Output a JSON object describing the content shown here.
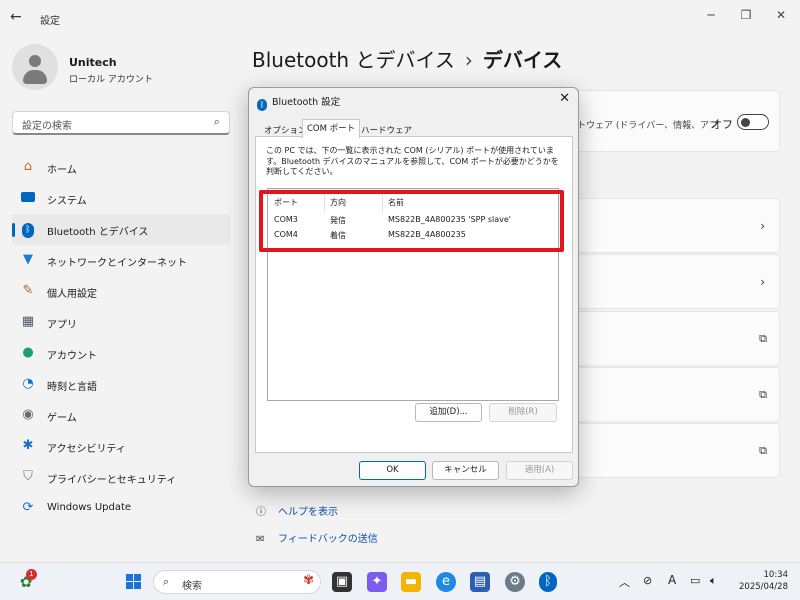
{
  "window": {
    "title": "設定",
    "back_icon": "arrow-left-icon"
  },
  "user": {
    "name": "Unitech",
    "account_type": "ローカル アカウント"
  },
  "search": {
    "placeholder": "設定の検索"
  },
  "sidebar": {
    "items": [
      {
        "label": "ホーム",
        "icon": "home-icon",
        "color": "#c86a1e"
      },
      {
        "label": "システム",
        "icon": "monitor-icon",
        "color": "#0067c0"
      },
      {
        "label": "Bluetooth とデバイス",
        "icon": "bluetooth-icon",
        "color": "#0067c0",
        "active": true
      },
      {
        "label": "ネットワークとインターネット",
        "icon": "wifi-icon",
        "color": "#1a7fd4"
      },
      {
        "label": "個人用設定",
        "icon": "brush-icon",
        "color": "#b5651d"
      },
      {
        "label": "アプリ",
        "icon": "apps-icon",
        "color": "#4a5a6a"
      },
      {
        "label": "アカウント",
        "icon": "person-icon",
        "color": "#1f9e75"
      },
      {
        "label": "時刻と言語",
        "icon": "globe-clock-icon",
        "color": "#1a6fc4"
      },
      {
        "label": "ゲーム",
        "icon": "gamepad-icon",
        "color": "#6b6b6b"
      },
      {
        "label": "アクセシビリティ",
        "icon": "accessibility-icon",
        "color": "#1a6fc4"
      },
      {
        "label": "プライバシーとセキュリティ",
        "icon": "shield-icon",
        "color": "#7a7a7a"
      },
      {
        "label": "Windows Update",
        "icon": "update-icon",
        "color": "#1a6fc4"
      }
    ]
  },
  "main": {
    "breadcrumb_parent": "Bluetooth とデバイス",
    "breadcrumb_separator": "›",
    "breadcrumb_current": "デバイス",
    "top_card_text": "トウェア (ドライバー、情報、アプ",
    "top_card_toggle_label": "オフ",
    "help_link": "ヘルプを表示",
    "feedback_link": "フィードバックの送信"
  },
  "dialog": {
    "title": "Bluetooth 設定",
    "tabs": [
      "オプション",
      "COM ポート",
      "ハードウェア"
    ],
    "selected_tab": 1,
    "description": "この PC では、下の一覧に表示された COM (シリアル) ポートが使用されています。Bluetooth デバイスのマニュアルを参照して、COM ポートが必要かどうかを判断してください。",
    "columns": [
      "ポート",
      "方向",
      "名前"
    ],
    "rows": [
      {
        "port": "COM3",
        "direction": "発信",
        "name": "MS822B_4A800235 'SPP slave'"
      },
      {
        "port": "COM4",
        "direction": "着信",
        "name": "MS822B_4A800235"
      }
    ],
    "add_button": "追加(D)...",
    "remove_button": "削除(R)",
    "ok_button": "OK",
    "cancel_button": "キャンセル",
    "apply_button": "適用(A)"
  },
  "taskbar": {
    "search_placeholder": "検索",
    "notification_badge": "1",
    "tray_language": "A",
    "time": "10:34",
    "date": "2025/04/28"
  },
  "colors": {
    "accent": "#0067c0",
    "highlight_border": "#e4141b"
  }
}
